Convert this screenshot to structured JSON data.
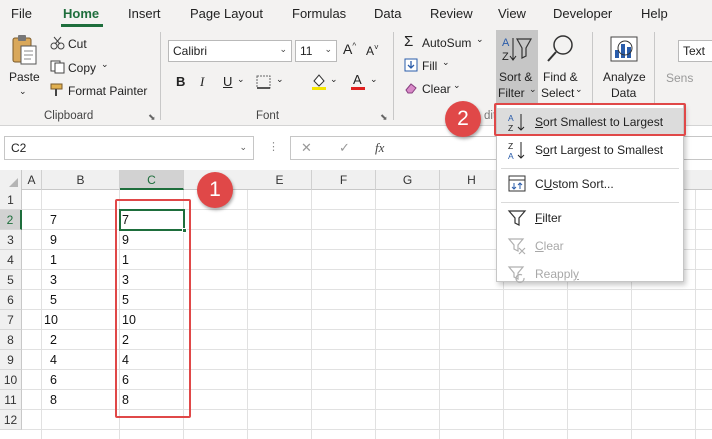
{
  "menu": {
    "tabs": [
      {
        "label": "File"
      },
      {
        "label": "Home"
      },
      {
        "label": "Insert"
      },
      {
        "label": "Page Layout"
      },
      {
        "label": "Formulas"
      },
      {
        "label": "Data"
      },
      {
        "label": "Review"
      },
      {
        "label": "View"
      },
      {
        "label": "Developer"
      },
      {
        "label": "Help"
      }
    ],
    "active_tab": "Home"
  },
  "ribbon": {
    "clipboard": {
      "paste": "Paste",
      "cut": "Cut",
      "copy": "Copy",
      "copy_arrow": "⌄",
      "format_painter": "Format Painter",
      "group_label": "Clipboard"
    },
    "font": {
      "font_name": "Calibri",
      "font_size": "11",
      "bold": "B",
      "italic": "I",
      "underline": "U",
      "group_label": "Font"
    },
    "editing": {
      "autosum": "AutoSum",
      "fill": "Fill",
      "clear": "Clear",
      "sort_filter_line1": "Sort &",
      "sort_filter_line2": "Filter",
      "find_select_line1": "Find &",
      "find_select_line2": "Select",
      "group_label_partial": "dit"
    },
    "analyze": {
      "line1": "Analyze",
      "line2": "Data"
    },
    "right_edge": {
      "text_partial": "Text",
      "sens_partial": "Sens"
    }
  },
  "formula_bar": {
    "name_box": "C2",
    "cancel": "✕",
    "enter": "✓",
    "fx": "fx"
  },
  "sheet": {
    "columns": [
      "A",
      "B",
      "C",
      "E",
      "F",
      "G",
      "H"
    ],
    "selected_column": "C",
    "rows": [
      "1",
      "2",
      "3",
      "4",
      "5",
      "6",
      "7",
      "8",
      "9",
      "10",
      "11",
      "12"
    ],
    "selected_row": "2",
    "column_b": [
      "7",
      "9",
      "1",
      "3",
      "5",
      "10",
      "2",
      "4",
      "6",
      "8"
    ],
    "column_c": [
      "7",
      "9",
      "1",
      "3",
      "5",
      "10",
      "2",
      "4",
      "6",
      "8"
    ]
  },
  "sort_menu": {
    "items": [
      {
        "label": "Sort Smallest to Largest",
        "accel": "S",
        "rest": "ort Smallest to Largest",
        "highlighted": true
      },
      {
        "label": "Sort Largest to Smallest",
        "accel": "o",
        "pre": "S",
        "rest": "rt Largest to Smallest"
      },
      {
        "label": "Custom Sort...",
        "accel": "U",
        "pre": "C",
        "rest": "stom Sort..."
      },
      {
        "label": "Filter",
        "accel": "F",
        "rest": "ilter"
      },
      {
        "label": "Clear",
        "accel": "C",
        "rest": "lear",
        "disabled": true
      },
      {
        "label": "Reapply",
        "accel": "y",
        "pre": "Reappl",
        "rest": "",
        "disabled": true
      }
    ]
  },
  "annotations": {
    "badge1": "1",
    "badge2": "2"
  },
  "colors": {
    "excel_green": "#1e6e3c",
    "annotation_red": "#e04848",
    "ribbon_bg": "#f3f2f1"
  }
}
